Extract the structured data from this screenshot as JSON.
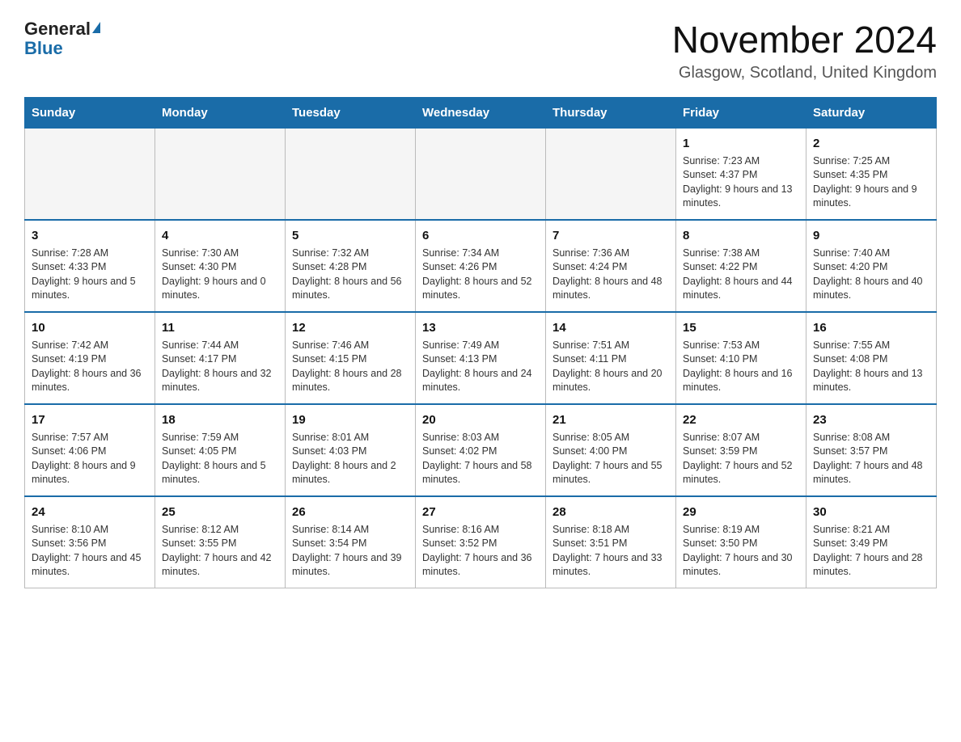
{
  "logo": {
    "general": "General",
    "blue": "Blue"
  },
  "title": "November 2024",
  "subtitle": "Glasgow, Scotland, United Kingdom",
  "weekdays": [
    "Sunday",
    "Monday",
    "Tuesday",
    "Wednesday",
    "Thursday",
    "Friday",
    "Saturday"
  ],
  "weeks": [
    [
      {
        "day": "",
        "info": ""
      },
      {
        "day": "",
        "info": ""
      },
      {
        "day": "",
        "info": ""
      },
      {
        "day": "",
        "info": ""
      },
      {
        "day": "",
        "info": ""
      },
      {
        "day": "1",
        "info": "Sunrise: 7:23 AM\nSunset: 4:37 PM\nDaylight: 9 hours and 13 minutes."
      },
      {
        "day": "2",
        "info": "Sunrise: 7:25 AM\nSunset: 4:35 PM\nDaylight: 9 hours and 9 minutes."
      }
    ],
    [
      {
        "day": "3",
        "info": "Sunrise: 7:28 AM\nSunset: 4:33 PM\nDaylight: 9 hours and 5 minutes."
      },
      {
        "day": "4",
        "info": "Sunrise: 7:30 AM\nSunset: 4:30 PM\nDaylight: 9 hours and 0 minutes."
      },
      {
        "day": "5",
        "info": "Sunrise: 7:32 AM\nSunset: 4:28 PM\nDaylight: 8 hours and 56 minutes."
      },
      {
        "day": "6",
        "info": "Sunrise: 7:34 AM\nSunset: 4:26 PM\nDaylight: 8 hours and 52 minutes."
      },
      {
        "day": "7",
        "info": "Sunrise: 7:36 AM\nSunset: 4:24 PM\nDaylight: 8 hours and 48 minutes."
      },
      {
        "day": "8",
        "info": "Sunrise: 7:38 AM\nSunset: 4:22 PM\nDaylight: 8 hours and 44 minutes."
      },
      {
        "day": "9",
        "info": "Sunrise: 7:40 AM\nSunset: 4:20 PM\nDaylight: 8 hours and 40 minutes."
      }
    ],
    [
      {
        "day": "10",
        "info": "Sunrise: 7:42 AM\nSunset: 4:19 PM\nDaylight: 8 hours and 36 minutes."
      },
      {
        "day": "11",
        "info": "Sunrise: 7:44 AM\nSunset: 4:17 PM\nDaylight: 8 hours and 32 minutes."
      },
      {
        "day": "12",
        "info": "Sunrise: 7:46 AM\nSunset: 4:15 PM\nDaylight: 8 hours and 28 minutes."
      },
      {
        "day": "13",
        "info": "Sunrise: 7:49 AM\nSunset: 4:13 PM\nDaylight: 8 hours and 24 minutes."
      },
      {
        "day": "14",
        "info": "Sunrise: 7:51 AM\nSunset: 4:11 PM\nDaylight: 8 hours and 20 minutes."
      },
      {
        "day": "15",
        "info": "Sunrise: 7:53 AM\nSunset: 4:10 PM\nDaylight: 8 hours and 16 minutes."
      },
      {
        "day": "16",
        "info": "Sunrise: 7:55 AM\nSunset: 4:08 PM\nDaylight: 8 hours and 13 minutes."
      }
    ],
    [
      {
        "day": "17",
        "info": "Sunrise: 7:57 AM\nSunset: 4:06 PM\nDaylight: 8 hours and 9 minutes."
      },
      {
        "day": "18",
        "info": "Sunrise: 7:59 AM\nSunset: 4:05 PM\nDaylight: 8 hours and 5 minutes."
      },
      {
        "day": "19",
        "info": "Sunrise: 8:01 AM\nSunset: 4:03 PM\nDaylight: 8 hours and 2 minutes."
      },
      {
        "day": "20",
        "info": "Sunrise: 8:03 AM\nSunset: 4:02 PM\nDaylight: 7 hours and 58 minutes."
      },
      {
        "day": "21",
        "info": "Sunrise: 8:05 AM\nSunset: 4:00 PM\nDaylight: 7 hours and 55 minutes."
      },
      {
        "day": "22",
        "info": "Sunrise: 8:07 AM\nSunset: 3:59 PM\nDaylight: 7 hours and 52 minutes."
      },
      {
        "day": "23",
        "info": "Sunrise: 8:08 AM\nSunset: 3:57 PM\nDaylight: 7 hours and 48 minutes."
      }
    ],
    [
      {
        "day": "24",
        "info": "Sunrise: 8:10 AM\nSunset: 3:56 PM\nDaylight: 7 hours and 45 minutes."
      },
      {
        "day": "25",
        "info": "Sunrise: 8:12 AM\nSunset: 3:55 PM\nDaylight: 7 hours and 42 minutes."
      },
      {
        "day": "26",
        "info": "Sunrise: 8:14 AM\nSunset: 3:54 PM\nDaylight: 7 hours and 39 minutes."
      },
      {
        "day": "27",
        "info": "Sunrise: 8:16 AM\nSunset: 3:52 PM\nDaylight: 7 hours and 36 minutes."
      },
      {
        "day": "28",
        "info": "Sunrise: 8:18 AM\nSunset: 3:51 PM\nDaylight: 7 hours and 33 minutes."
      },
      {
        "day": "29",
        "info": "Sunrise: 8:19 AM\nSunset: 3:50 PM\nDaylight: 7 hours and 30 minutes."
      },
      {
        "day": "30",
        "info": "Sunrise: 8:21 AM\nSunset: 3:49 PM\nDaylight: 7 hours and 28 minutes."
      }
    ]
  ]
}
